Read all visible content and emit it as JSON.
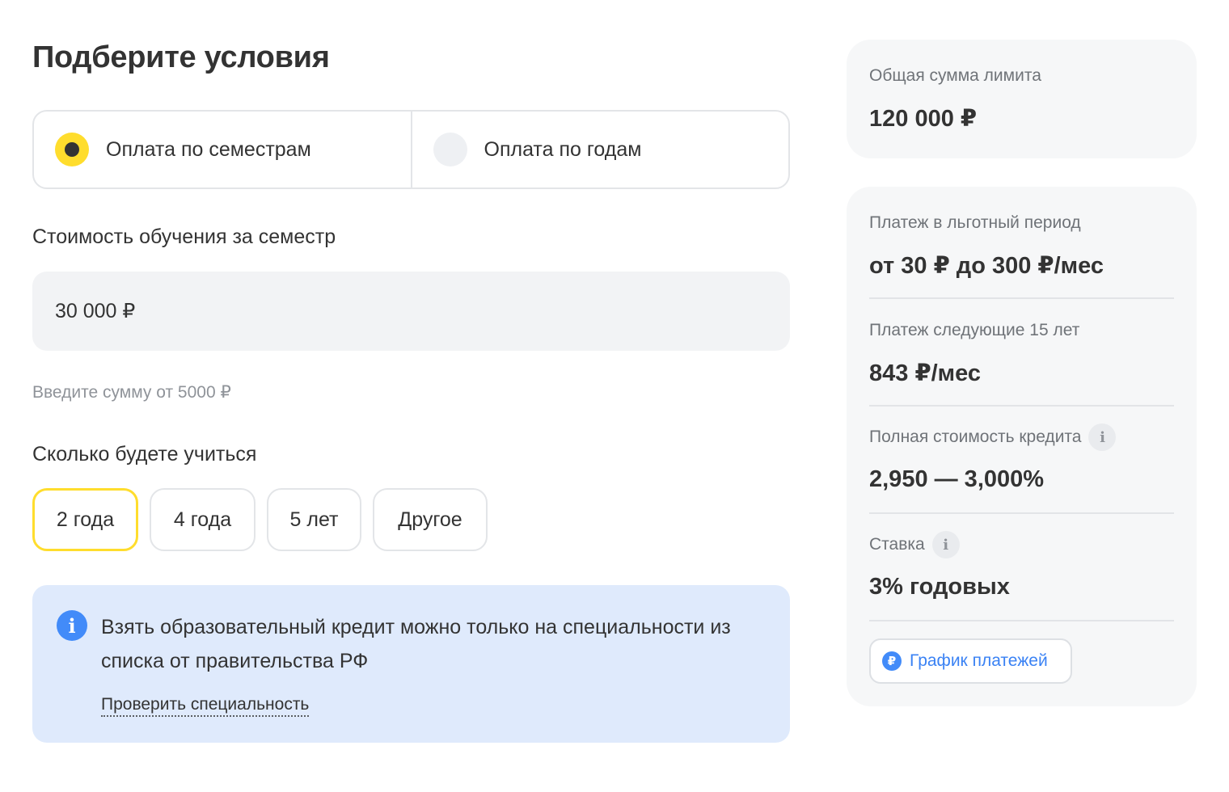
{
  "title": "Подберите условия",
  "payment_mode": {
    "options": [
      {
        "label": "Оплата по семестрам",
        "selected": true
      },
      {
        "label": "Оплата по годам",
        "selected": false
      }
    ]
  },
  "cost": {
    "label": "Стоимость обучения за семестр",
    "value": "30 000 ₽",
    "hint": "Введите сумму от 5000 ₽"
  },
  "duration": {
    "label": "Сколько будете учиться",
    "options": [
      "2 года",
      "4 года",
      "5 лет",
      "Другое"
    ],
    "selected": "2 года"
  },
  "info": {
    "text": "Взять образовательный кредит можно только на специальности из списка от правительства РФ",
    "link": "Проверить специальность"
  },
  "summary": {
    "limit_label": "Общая сумма лимита",
    "limit_value": "120 000 ₽",
    "grace_label": "Платеж в льготный период",
    "grace_value": "от 30 ₽ до 300 ₽/мес",
    "next_label": "Платеж следующие 15 лет",
    "next_value": "843 ₽/мес",
    "full_cost_label": "Полная стоимость кредита",
    "full_cost_value": "2,950 — 3,000%",
    "rate_label": "Ставка",
    "rate_value": "3% годовых",
    "schedule_button": "График платежей"
  },
  "colors": {
    "accent_yellow": "#ffdd2d",
    "info_bg": "#dfeafc",
    "link_blue": "#3a82f4"
  }
}
